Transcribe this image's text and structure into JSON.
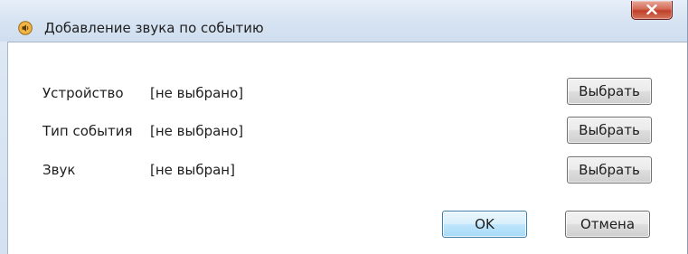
{
  "window": {
    "title": "Добавление звука по событию",
    "close_label": "x"
  },
  "rows": [
    {
      "label": "Устройство",
      "value": "[не выбрано]",
      "button": "Выбрать"
    },
    {
      "label": "Тип события",
      "value": "[не выбрано]",
      "button": "Выбрать"
    },
    {
      "label": "Звук",
      "value": "[не выбран]",
      "button": "Выбрать"
    }
  ],
  "footer": {
    "ok_label": "OK",
    "cancel_label": "Отмена"
  },
  "colors": {
    "titlebar": "#d6e3f2",
    "close_button": "#c0402a",
    "default_button_border": "#3c7fb1"
  },
  "icons": {
    "title": "speaker-icon",
    "close": "close-icon"
  }
}
